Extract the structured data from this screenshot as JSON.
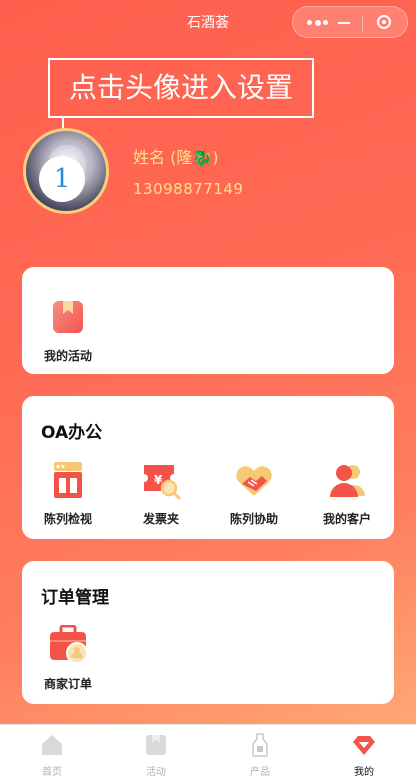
{
  "header": {
    "title": "石酒荟"
  },
  "profile": {
    "tip": "点击头像进入设置",
    "badge_number": "1",
    "name": "姓名 (隆🐉)",
    "phone": "13098877149"
  },
  "card_activity": {
    "items": [
      {
        "label": "我的活动",
        "icon": "activity-bookmark-icon"
      }
    ]
  },
  "card_oa": {
    "title": "OA办公",
    "items": [
      {
        "label": "陈列检视",
        "icon": "display-inspection-icon"
      },
      {
        "label": "发票夹",
        "icon": "invoice-folder-icon"
      },
      {
        "label": "陈列协助",
        "icon": "handshake-icon"
      },
      {
        "label": "我的客户",
        "icon": "customers-icon"
      }
    ]
  },
  "card_order": {
    "title": "订单管理",
    "items": [
      {
        "label": "商家订单",
        "icon": "merchant-order-icon"
      }
    ]
  },
  "tabbar": {
    "items": [
      {
        "label": "首页",
        "icon": "home-icon"
      },
      {
        "label": "活动",
        "icon": "activity-icon"
      },
      {
        "label": "产品",
        "icon": "product-bottle-icon"
      },
      {
        "label": "我的",
        "icon": "profile-gem-icon",
        "active": true
      }
    ]
  },
  "colors": {
    "accent": "#ff5f4e",
    "icon_red": "#f4534a",
    "icon_yellow": "#f8c974",
    "name_text": "#ffe08a"
  }
}
